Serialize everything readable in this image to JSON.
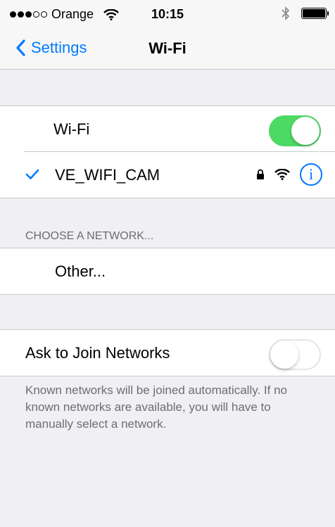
{
  "status_bar": {
    "carrier": "Orange",
    "time": "10:15",
    "signal_bars_filled": 3,
    "signal_bars_total": 5
  },
  "nav": {
    "back_label": "Settings",
    "title": "Wi-Fi"
  },
  "wifi_section": {
    "wifi_label": "Wi-Fi",
    "wifi_enabled": true,
    "connected_network": "VE_WIFI_CAM",
    "info_glyph": "i"
  },
  "choose_section": {
    "header": "CHOOSE A NETWORK...",
    "other_label": "Other..."
  },
  "ask_section": {
    "ask_label": "Ask to Join Networks",
    "ask_enabled": false,
    "footer_text": "Known networks will be joined automatically. If no known networks are available, you will have to manually select a network."
  },
  "colors": {
    "accent": "#007aff",
    "toggle_on": "#4cd964",
    "background": "#efeff4"
  },
  "icons": [
    "signal-dots-icon",
    "wifi-icon",
    "bluetooth-icon",
    "battery-icon",
    "chevron-left-icon",
    "checkmark-icon",
    "lock-icon",
    "info-icon"
  ]
}
